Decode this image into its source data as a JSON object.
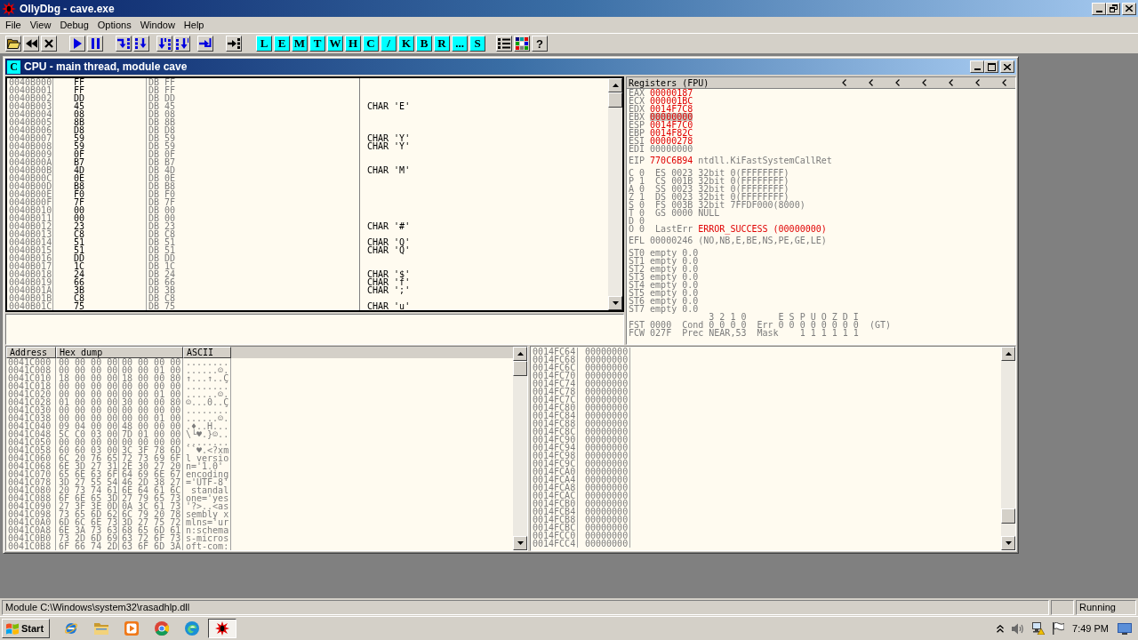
{
  "window": {
    "title": "OllyDbg - cave.exe"
  },
  "menu": [
    "File",
    "View",
    "Debug",
    "Options",
    "Window",
    "Help"
  ],
  "toolbar": {
    "window_buttons": [
      "L",
      "E",
      "M",
      "T",
      "W",
      "H",
      "C",
      "/",
      "K",
      "B",
      "R",
      "...",
      "S"
    ],
    "help_button": "?"
  },
  "cpu_window": {
    "badge": "C",
    "title": "CPU - main thread, module cave",
    "disassembly": [
      {
        "address": "0040B000",
        "hex": "FF",
        "command": "DB FF"
      },
      {
        "address": "0040B001",
        "hex": "FF",
        "command": "DB FF"
      },
      {
        "address": "0040B002",
        "hex": "DD",
        "command": "DB DD"
      },
      {
        "address": "0040B003",
        "hex": "45",
        "command": "DB 45",
        "comment": "CHAR 'E'"
      },
      {
        "address": "0040B004",
        "hex": "08",
        "command": "DB 08"
      },
      {
        "address": "0040B005",
        "hex": "8B",
        "command": "DB 8B"
      },
      {
        "address": "0040B006",
        "hex": "D8",
        "command": "DB D8"
      },
      {
        "address": "0040B007",
        "hex": "59",
        "command": "DB 59",
        "comment": "CHAR 'Y'"
      },
      {
        "address": "0040B008",
        "hex": "59",
        "command": "DB 59",
        "comment": "CHAR 'Y'"
      },
      {
        "address": "0040B009",
        "hex": "0F",
        "command": "DB 0F"
      },
      {
        "address": "0040B00A",
        "hex": "B7",
        "command": "DB B7"
      },
      {
        "address": "0040B00B",
        "hex": "4D",
        "command": "DB 4D",
        "comment": "CHAR 'M'"
      },
      {
        "address": "0040B00C",
        "hex": "0E",
        "command": "DB 0E"
      },
      {
        "address": "0040B00D",
        "hex": "B8",
        "command": "DB B8"
      },
      {
        "address": "0040B00E",
        "hex": "F0",
        "command": "DB F0"
      },
      {
        "address": "0040B00F",
        "hex": "7F",
        "command": "DB 7F"
      },
      {
        "address": "0040B010",
        "hex": "00",
        "command": "DB 00"
      },
      {
        "address": "0040B011",
        "hex": "00",
        "command": "DB 00"
      },
      {
        "address": "0040B012",
        "hex": "23",
        "command": "DB 23",
        "comment": "CHAR '#'"
      },
      {
        "address": "0040B013",
        "hex": "C8",
        "command": "DB C8"
      },
      {
        "address": "0040B014",
        "hex": "51",
        "command": "DB 51",
        "comment": "CHAR 'Q'"
      },
      {
        "address": "0040B015",
        "hex": "51",
        "command": "DB 51",
        "comment": "CHAR 'Q'"
      },
      {
        "address": "0040B016",
        "hex": "DD",
        "command": "DB DD"
      },
      {
        "address": "0040B017",
        "hex": "1C",
        "command": "DB 1C"
      },
      {
        "address": "0040B018",
        "hex": "24",
        "command": "DB 24",
        "comment": "CHAR '$'"
      },
      {
        "address": "0040B019",
        "hex": "66",
        "command": "DB 66",
        "comment": "CHAR 'f'"
      },
      {
        "address": "0040B01A",
        "hex": "3B",
        "command": "DB 3B",
        "comment": "CHAR ';'"
      },
      {
        "address": "0040B01B",
        "hex": "C8",
        "command": "DB C8"
      },
      {
        "address": "0040B01C",
        "hex": "75",
        "command": "DB 75",
        "comment": "CHAR 'u'"
      }
    ],
    "registers_header": "Registers (FPU)",
    "registers": [
      {
        "name": "EAX",
        "value": "00000187",
        "changed": true,
        "selected": false
      },
      {
        "name": "ECX",
        "value": "000001BC",
        "changed": true,
        "selected": false
      },
      {
        "name": "EDX",
        "value": "0014F7C8",
        "changed": true,
        "selected": false
      },
      {
        "name": "EBX",
        "value": "00000000",
        "changed": true,
        "selected": true
      },
      {
        "name": "ESP",
        "value": "0014F7C0",
        "changed": true,
        "selected": false
      },
      {
        "name": "EBP",
        "value": "0014F82C",
        "changed": true,
        "selected": false
      },
      {
        "name": "ESI",
        "value": "00000278",
        "changed": true,
        "selected": false
      },
      {
        "name": "EDI",
        "value": "00000000",
        "changed": false,
        "selected": false
      }
    ],
    "eip": {
      "name": "EIP",
      "value": "770C6B94",
      "changed": true,
      "symbol": "ntdll.KiFastSystemCallRet"
    },
    "flags": [
      {
        "flag": "C 0",
        "segment": "ES 0023 32bit 0(FFFFFFFF)"
      },
      {
        "flag": "P 1",
        "segment": "CS 001B 32bit 0(FFFFFFFF)"
      },
      {
        "flag": "A 0",
        "segment": "SS 0023 32bit 0(FFFFFFFF)"
      },
      {
        "flag": "Z 1",
        "segment": "DS 0023 32bit 0(FFFFFFFF)"
      },
      {
        "flag": "S 0",
        "segment": "FS 003B 32bit 7FFDF000(8000)"
      },
      {
        "flag": "T 0",
        "segment": "GS 0000 NULL"
      },
      {
        "flag": "D 0"
      },
      {
        "flag": "O 0",
        "last_error": {
          "label": "LastErr",
          "value": "ERROR_SUCCESS (00000000)",
          "changed": true
        }
      }
    ],
    "efl": "EFL 00000246 (NO,NB,E,BE,NS,PE,GE,LE)",
    "fpu": [
      "ST0 empty 0.0",
      "ST1 empty 0.0",
      "ST2 empty 0.0",
      "ST3 empty 0.0",
      "ST4 empty 0.0",
      "ST5 empty 0.0",
      "ST6 empty 0.0",
      "ST7 empty 0.0"
    ],
    "fpu_status": {
      "cond_header": "3 2 1 0",
      "err_header": "E S P U O Z D I",
      "fst": "FST 0000",
      "cond_label": "Cond",
      "cond": "0 0 0 0",
      "err_label": "Err",
      "err": "0 0 0 0 0 0 0 0",
      "compare": "(GT)",
      "fcw": "FCW 027F",
      "prec_label": "Prec",
      "prec": "NEAR,53",
      "mask_label": "Mask",
      "mask": "1 1 1 1 1 1"
    },
    "dump": {
      "columns": [
        "Address",
        "Hex dump",
        "ASCII"
      ],
      "rows": [
        {
          "address": "0041C000",
          "hex": [
            "00 00 00 00",
            "00 00 00 00"
          ],
          "ascii": "........"
        },
        {
          "address": "0041C008",
          "hex": [
            "00 00 00 00",
            "00 00 01 00"
          ],
          "ascii": "......☺."
        },
        {
          "address": "0041C010",
          "hex": [
            "18 00 00 00",
            "18 00 00 80"
          ],
          "ascii": "↑...↑..Ç"
        },
        {
          "address": "0041C018",
          "hex": [
            "00 00 00 00",
            "00 00 00 00"
          ],
          "ascii": "........"
        },
        {
          "address": "0041C020",
          "hex": [
            "00 00 00 00",
            "00 00 01 00"
          ],
          "ascii": "......☺."
        },
        {
          "address": "0041C028",
          "hex": [
            "01 00 00 00",
            "30 00 00 80"
          ],
          "ascii": "☺...0..Ç"
        },
        {
          "address": "0041C030",
          "hex": [
            "00 00 00 00",
            "00 00 00 00"
          ],
          "ascii": "........"
        },
        {
          "address": "0041C038",
          "hex": [
            "00 00 00 00",
            "00 00 01 00"
          ],
          "ascii": "......☺."
        },
        {
          "address": "0041C040",
          "hex": [
            "09 04 00 00",
            "48 00 00 00"
          ],
          "ascii": ".♦..H..."
        },
        {
          "address": "0041C048",
          "hex": [
            "5C C0 03 00",
            "7D 01 00 00"
          ],
          "ascii": "\\└♥.}☺.."
        },
        {
          "address": "0041C050",
          "hex": [
            "00 00 00 00",
            "00 00 00 00"
          ],
          "ascii": "........"
        },
        {
          "address": "0041C058",
          "hex": [
            "60 60 03 00",
            "3C 3F 78 6D"
          ],
          "ascii": "``♥.<?xm"
        },
        {
          "address": "0041C060",
          "hex": [
            "6C 20 76 65",
            "72 73 69 6F"
          ],
          "ascii": "l versio"
        },
        {
          "address": "0041C068",
          "hex": [
            "6E 3D 27 31",
            "2E 30 27 20"
          ],
          "ascii": "n='1.0'"
        },
        {
          "address": "0041C070",
          "hex": [
            "65 6E 63 6F",
            "64 69 6E 67"
          ],
          "ascii": "encoding"
        },
        {
          "address": "0041C078",
          "hex": [
            "3D 27 55 54",
            "46 2D 38 27"
          ],
          "ascii": "='UTF-8'"
        },
        {
          "address": "0041C080",
          "hex": [
            "20 73 74 61",
            "6E 64 61 6C"
          ],
          "ascii": " standal"
        },
        {
          "address": "0041C088",
          "hex": [
            "6F 6E 65 3D",
            "27 79 65 73"
          ],
          "ascii": "one='yes"
        },
        {
          "address": "0041C090",
          "hex": [
            "27 3F 3E 0D",
            "0A 3C 61 73"
          ],
          "ascii": "'?>..<as"
        },
        {
          "address": "0041C098",
          "hex": [
            "73 65 6D 62",
            "6C 79 20 78"
          ],
          "ascii": "sembly x"
        },
        {
          "address": "0041C0A0",
          "hex": [
            "6D 6C 6E 73",
            "3D 27 75 72"
          ],
          "ascii": "mlns='ur"
        },
        {
          "address": "0041C0A8",
          "hex": [
            "6E 3A 73 63",
            "68 65 6D 61"
          ],
          "ascii": "n:schema"
        },
        {
          "address": "0041C0B0",
          "hex": [
            "73 2D 6D 69",
            "63 72 6F 73"
          ],
          "ascii": "s-micros"
        },
        {
          "address": "0041C0B8",
          "hex": [
            "6F 66 74 2D",
            "63 6F 6D 3A"
          ],
          "ascii": "oft-com:"
        }
      ]
    },
    "stack": [
      {
        "address": "0014FC64",
        "value": "00000000"
      },
      {
        "address": "0014FC68",
        "value": "00000000"
      },
      {
        "address": "0014FC6C",
        "value": "00000000"
      },
      {
        "address": "0014FC70",
        "value": "00000000"
      },
      {
        "address": "0014FC74",
        "value": "00000000"
      },
      {
        "address": "0014FC78",
        "value": "00000000"
      },
      {
        "address": "0014FC7C",
        "value": "00000000"
      },
      {
        "address": "0014FC80",
        "value": "00000000"
      },
      {
        "address": "0014FC84",
        "value": "00000000"
      },
      {
        "address": "0014FC88",
        "value": "00000000"
      },
      {
        "address": "0014FC8C",
        "value": "00000000"
      },
      {
        "address": "0014FC90",
        "value": "00000000"
      },
      {
        "address": "0014FC94",
        "value": "00000000"
      },
      {
        "address": "0014FC98",
        "value": "00000000"
      },
      {
        "address": "0014FC9C",
        "value": "00000000"
      },
      {
        "address": "0014FCA0",
        "value": "00000000"
      },
      {
        "address": "0014FCA4",
        "value": "00000000"
      },
      {
        "address": "0014FCA8",
        "value": "00000000"
      },
      {
        "address": "0014FCAC",
        "value": "00000000"
      },
      {
        "address": "0014FCB0",
        "value": "00000000"
      },
      {
        "address": "0014FCB4",
        "value": "00000000"
      },
      {
        "address": "0014FCB8",
        "value": "00000000"
      },
      {
        "address": "0014FCBC",
        "value": "00000000"
      },
      {
        "address": "0014FCC0",
        "value": "00000000"
      },
      {
        "address": "0014FCC4",
        "value": "00000000"
      }
    ]
  },
  "status_bar": {
    "message": "Module C:\\Windows\\system32\\rasadhlp.dll",
    "state": "Running"
  },
  "taskbar": {
    "start": "Start",
    "apps": [
      {
        "selected": false
      },
      {
        "selected": false
      },
      {
        "selected": false
      },
      {
        "selected": false
      },
      {
        "selected": false
      },
      {
        "selected": true
      }
    ],
    "clock": "7:49 PM"
  }
}
